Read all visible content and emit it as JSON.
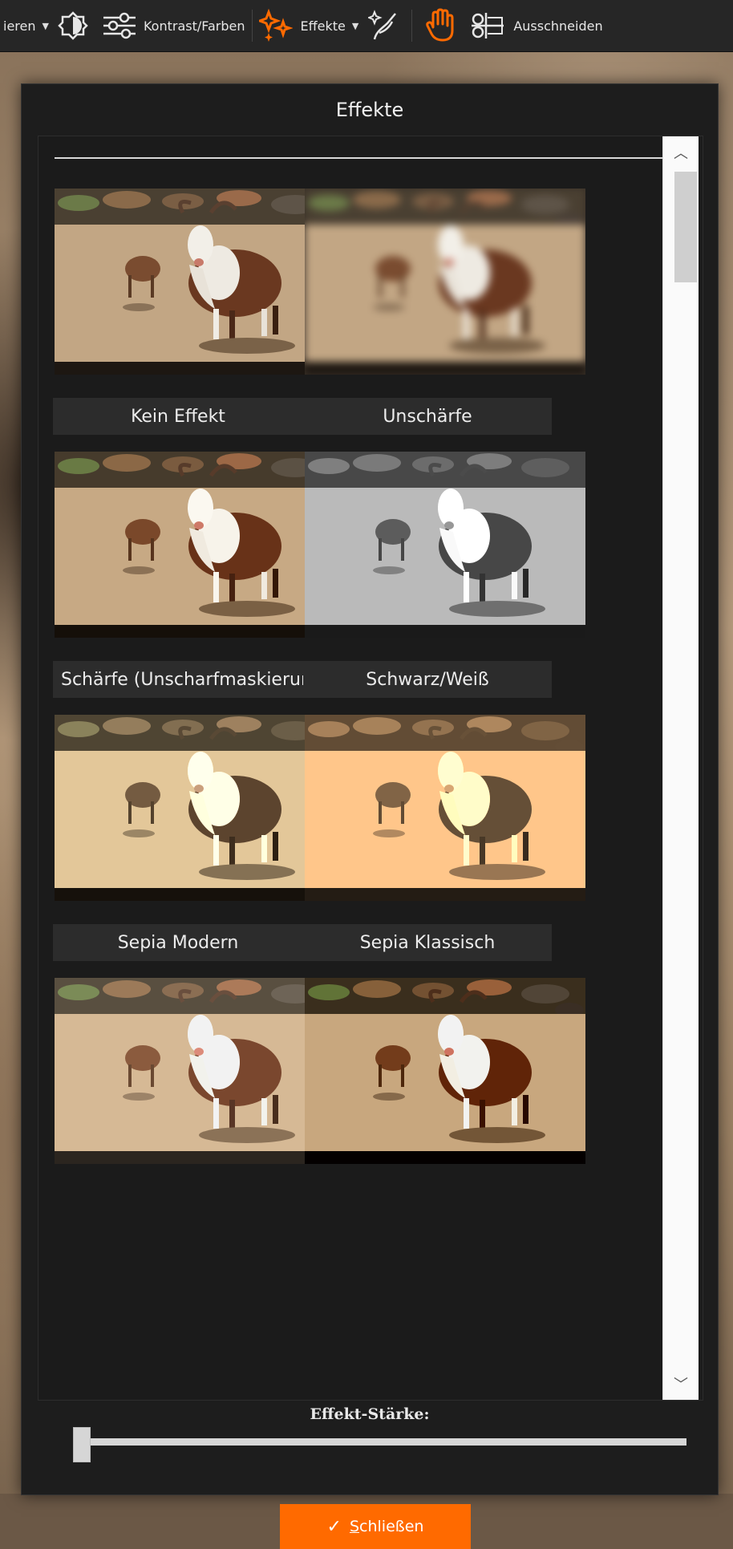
{
  "toolbar": {
    "items": [
      {
        "label": "ieren",
        "has_caret": true
      },
      {
        "icon": "brightness-icon"
      },
      {
        "label": "Kontrast/Farben",
        "icon": "sliders-icon"
      },
      {
        "label": "Effekte",
        "icon": "sparkle-icon",
        "has_caret": true,
        "active": true
      },
      {
        "icon": "magic-brush-icon"
      },
      {
        "icon": "hand-icon",
        "active": true
      },
      {
        "label": "Ausschneiden",
        "icon": "scissors-icon"
      }
    ],
    "accent_color": "#ff6a00"
  },
  "dialog": {
    "title": "Effekte",
    "effects": [
      {
        "label": "Kein Effekt",
        "style": "normal"
      },
      {
        "label": "Unschärfe",
        "style": "blur"
      },
      {
        "label": "Schärfe (Unscharfmaskierun...",
        "style": "sharp"
      },
      {
        "label": "Schwarz/Weiß",
        "style": "bw"
      },
      {
        "label": "Sepia Modern",
        "style": "sepia-modern"
      },
      {
        "label": "Sepia Klassisch",
        "style": "sepia-classic"
      },
      {
        "label": "",
        "style": "soft"
      },
      {
        "label": "",
        "style": "contrast"
      }
    ],
    "strength_label": "Effekt-Stärke:",
    "strength_value": 0,
    "close_button": {
      "first_letter": "S",
      "rest": "chließen"
    }
  }
}
